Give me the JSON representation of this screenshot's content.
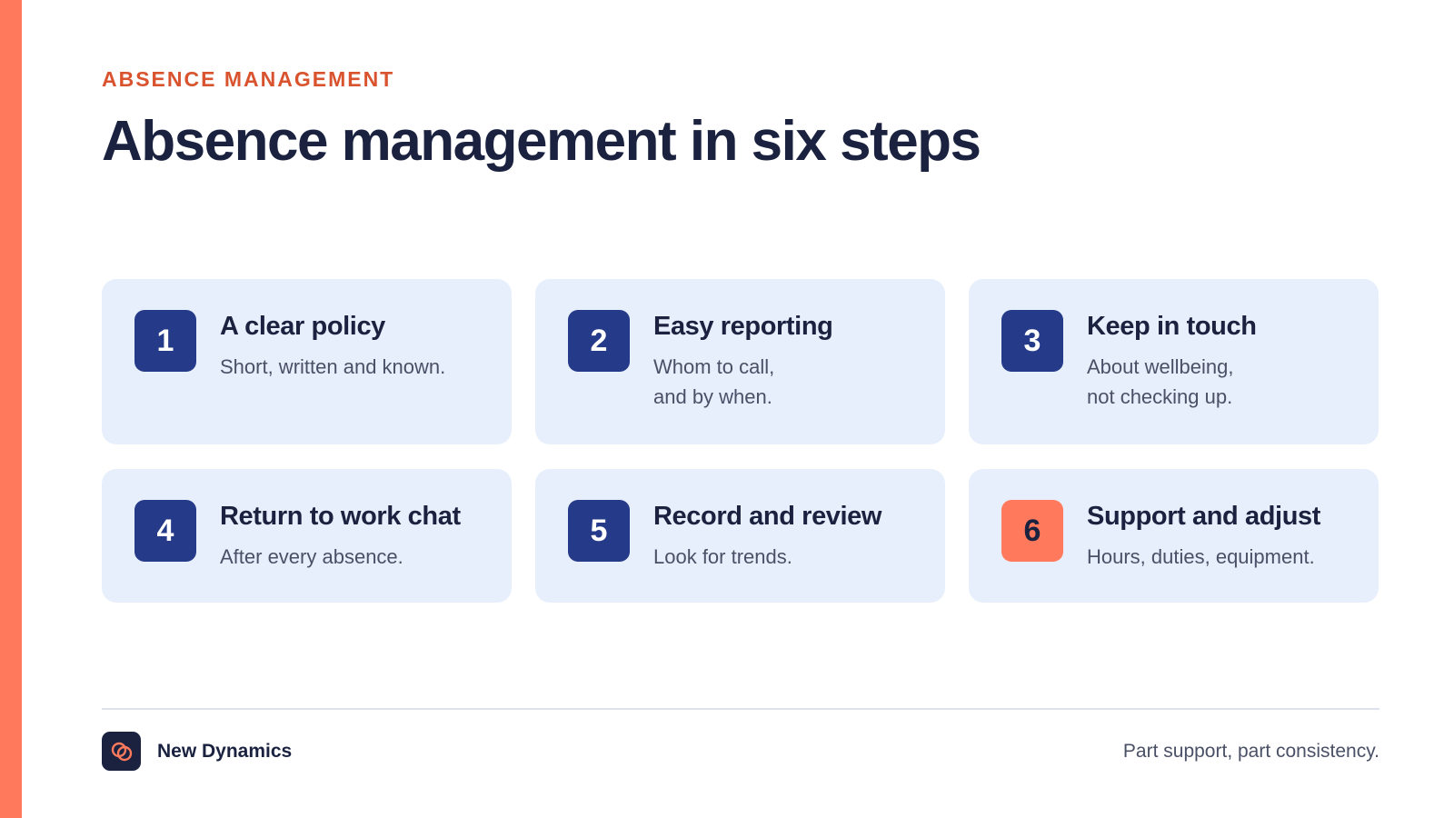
{
  "eyebrow": "ABSENCE MANAGEMENT",
  "title": "Absence management in six steps",
  "steps": [
    {
      "number": "1",
      "title": "A clear policy",
      "description": "Short, written and known."
    },
    {
      "number": "2",
      "title": "Easy reporting",
      "description": "Whom to call,\nand by when."
    },
    {
      "number": "3",
      "title": "Keep in touch",
      "description": "About wellbeing,\nnot checking up."
    },
    {
      "number": "4",
      "title": "Return to work chat",
      "description": "After every absence."
    },
    {
      "number": "5",
      "title": "Record and review",
      "description": "Look for trends."
    },
    {
      "number": "6",
      "title": "Support and adjust",
      "description": "Hours, duties, equipment."
    }
  ],
  "footer": {
    "brand": "New Dynamics",
    "tagline": "Part support, part consistency.",
    "logo_icon": "interlocking-rings-icon"
  },
  "colors": {
    "accent": "#ff7a5c",
    "eyebrow": "#d9532f",
    "navy": "#1a2240",
    "badge": "#253b8a",
    "card_bg": "#e8effc"
  }
}
